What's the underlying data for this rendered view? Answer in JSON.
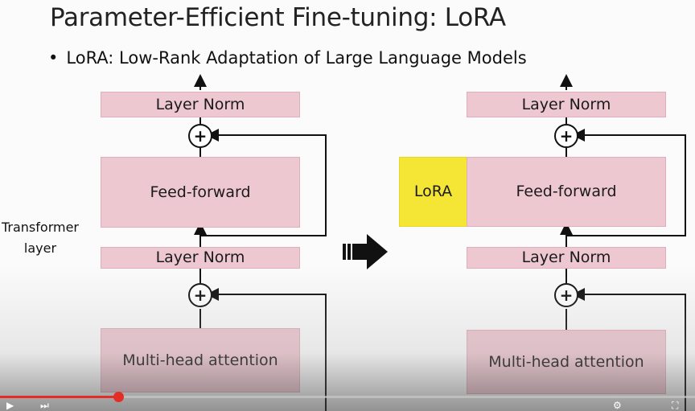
{
  "slide": {
    "title": "Parameter-Efficient Fine-tuning: LoRA",
    "bullet": "LoRA: Low-Rank Adaptation of Large Language Models",
    "side_label": "Transformer layer"
  },
  "left_diagram": {
    "top_norm": "Layer Norm",
    "feed_forward": "Feed-forward",
    "mid_norm": "Layer Norm",
    "attention": "Multi-head attention",
    "plus": "+"
  },
  "right_diagram": {
    "top_norm": "Layer Norm",
    "lora": "LoRA",
    "feed_forward": "Feed-forward",
    "mid_norm": "Layer Norm",
    "attention": "Multi-head attention",
    "plus": "+"
  },
  "colors": {
    "block_pink": "#eec8d1",
    "lora_yellow": "#f5e636",
    "progress_red": "#e52d27"
  },
  "player": {
    "progress_fraction": 0.17,
    "icons": [
      "play-icon",
      "next-icon",
      "volume-icon",
      "settings-icon",
      "fullscreen-icon"
    ]
  }
}
